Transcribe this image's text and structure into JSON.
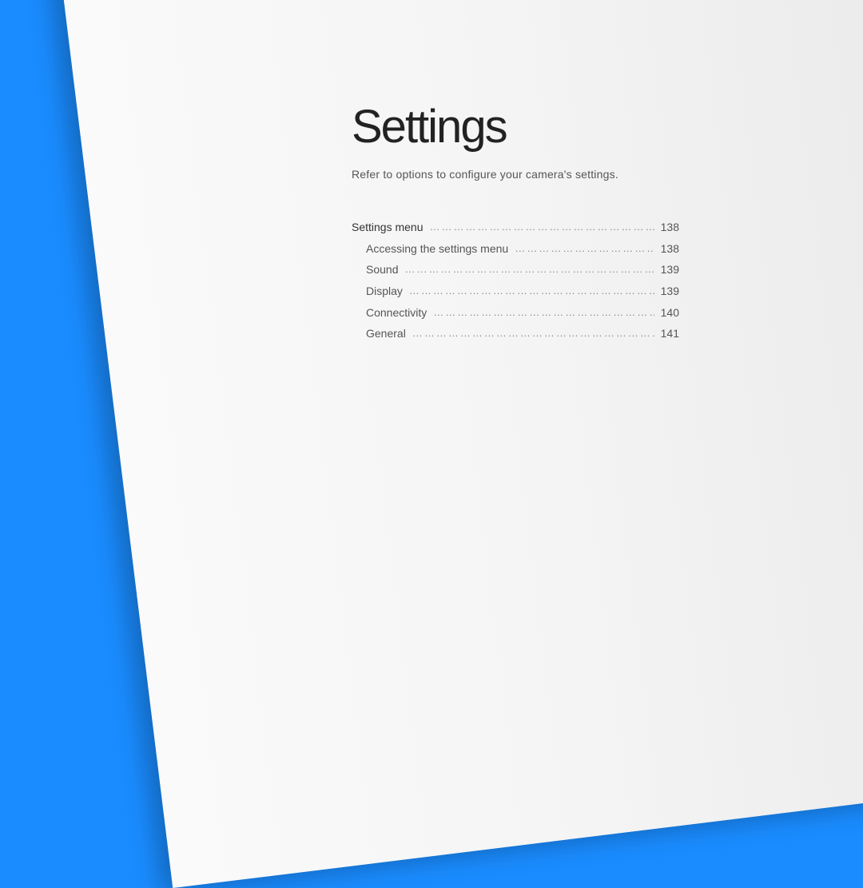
{
  "title": "Settings",
  "subtitle": "Refer to options to configure your camera's settings.",
  "toc": {
    "section": {
      "label": "Settings menu",
      "page": "138"
    },
    "items": [
      {
        "label": "Accessing the settings menu",
        "page": "138"
      },
      {
        "label": "Sound",
        "page": "139"
      },
      {
        "label": "Display",
        "page": "139"
      },
      {
        "label": "Connectivity",
        "page": "140"
      },
      {
        "label": "General",
        "page": "141"
      }
    ]
  }
}
